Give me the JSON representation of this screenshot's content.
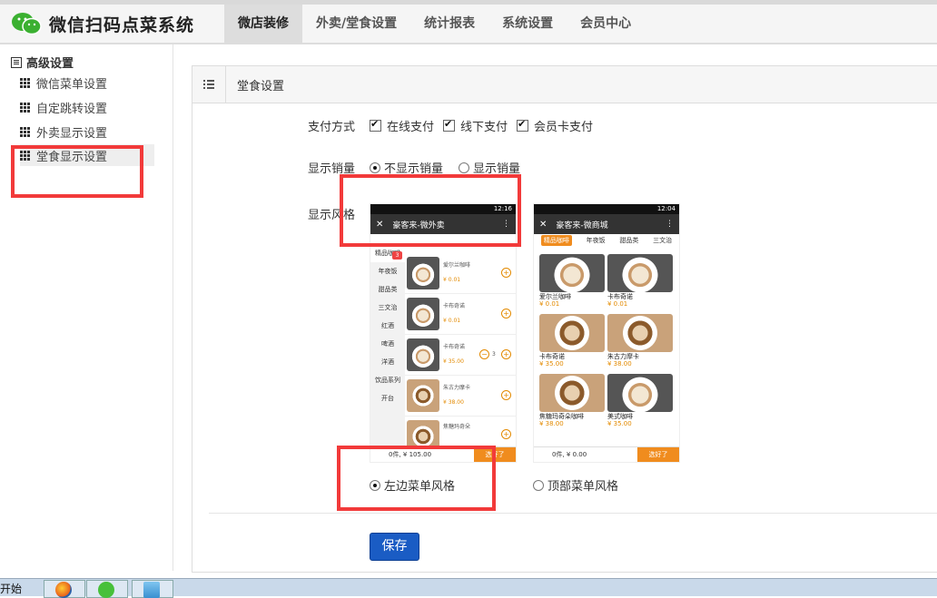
{
  "app": {
    "title": "微信扫码点菜系统",
    "nav": [
      "微店装修",
      "外卖/堂食设置",
      "统计报表",
      "系统设置",
      "会员中心"
    ],
    "active_nav": "微店装修"
  },
  "sidebar": {
    "title": "高级设置",
    "items": [
      {
        "label": "微信菜单设置"
      },
      {
        "label": "自定跳转设置"
      },
      {
        "label": "外卖显示设置"
      },
      {
        "label": "堂食显示设置"
      }
    ]
  },
  "panel": {
    "title": "堂食设置",
    "payment": {
      "label": "支付方式",
      "options": [
        {
          "label": "在线支付",
          "checked": true
        },
        {
          "label": "线下支付",
          "checked": true
        },
        {
          "label": "会员卡支付",
          "checked": true
        }
      ]
    },
    "sales": {
      "label": "显示销量",
      "options": [
        {
          "label": "不显示销量",
          "selected": true
        },
        {
          "label": "显示销量",
          "selected": false
        }
      ]
    },
    "style": {
      "label": "显示风格",
      "options": [
        {
          "label": "左边菜单风格",
          "selected": true
        },
        {
          "label": "顶部菜单风格",
          "selected": false
        }
      ]
    },
    "save_label": "保存"
  },
  "preview_left": {
    "time": "12:16",
    "title": "豪客来-微外卖",
    "categories": [
      "精品咖啡",
      "年夜饭",
      "甜品类",
      "三文治",
      "红酒",
      "啤酒",
      "洋酒",
      "饮品系列",
      "开台"
    ],
    "badge": "3",
    "items": [
      {
        "name": "爱尔兰咖啡",
        "price": "¥ 0.01"
      },
      {
        "name": "卡布奇诺",
        "price": "¥ 0.01"
      },
      {
        "name": "卡布奇诺",
        "price": "¥ 35.00",
        "qty": "3"
      },
      {
        "name": "朱古力摩卡",
        "price": "¥ 38.00"
      },
      {
        "name": "焦糖玛奇朵",
        "price": ""
      }
    ],
    "bottom_count": "0件, ¥ 105.00",
    "bottom_button": "选好了"
  },
  "preview_right": {
    "time": "12:04",
    "title": "豪客来-微商城",
    "tabs": [
      "精品咖啡",
      "年夜饭",
      "甜品类",
      "三文治"
    ],
    "items": [
      {
        "name": "爱尔兰咖啡",
        "price": "¥ 0.01"
      },
      {
        "name": "卡布奇诺",
        "price": "¥ 0.01"
      },
      {
        "name": "卡布奇诺",
        "price": "¥ 35.00"
      },
      {
        "name": "朱古力摩卡",
        "price": "¥ 38.00"
      },
      {
        "name": "焦糖玛奇朵咖啡",
        "price": "¥ 38.00"
      },
      {
        "name": "美式咖啡",
        "price": "¥ 35.00"
      }
    ],
    "bottom_count": "0件, ¥ 0.00",
    "bottom_button": "选好了"
  },
  "taskbar": {
    "start": "开始"
  },
  "colors": {
    "annotation_red": "#f23a3a",
    "save_button": "#1a5cc4",
    "accent_orange": "#f08c1e"
  }
}
